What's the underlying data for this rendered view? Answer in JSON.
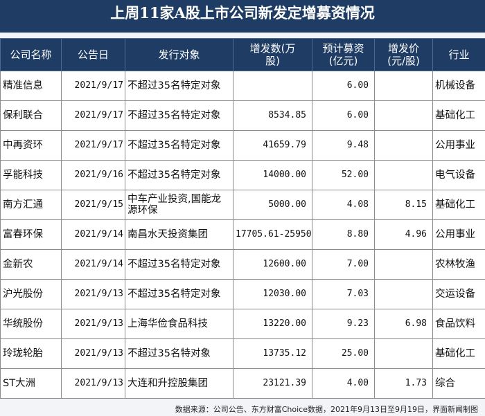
{
  "title": "上周11家A股上市公司新发定增募资情况",
  "headers": [
    "公司名称",
    "公告日",
    "发行对象",
    "增发数(万\n股)",
    "预计募资\n(亿元)",
    "增发价\n(元/股)",
    "行业"
  ],
  "rows": [
    {
      "company": "精准信息",
      "date": "2021/9/17",
      "target": "不超过35名特定对象",
      "shares": "",
      "raise": "6.00",
      "price": "",
      "industry": "机械设备"
    },
    {
      "company": "保利联合",
      "date": "2021/9/17",
      "target": "不超过35名特定对象",
      "shares": "8534.85",
      "raise": "6.00",
      "price": "",
      "industry": "基础化工"
    },
    {
      "company": "中再资环",
      "date": "2021/9/17",
      "target": "不超过35名特定对象",
      "shares": "41659.79",
      "raise": "9.48",
      "price": "",
      "industry": "公用事业"
    },
    {
      "company": "孚能科技",
      "date": "2021/9/16",
      "target": "不超过35名特定对象",
      "shares": "14000.00",
      "raise": "52.00",
      "price": "",
      "industry": "电气设备"
    },
    {
      "company": "南方汇通",
      "date": "2021/9/15",
      "target": "中车产业投资,国能龙源环保",
      "shares": "5000.00",
      "raise": "4.08",
      "price": "8.15",
      "industry": "基础化工"
    },
    {
      "company": "富春环保",
      "date": "2021/9/14",
      "target": "南昌水天投资集团",
      "shares": "17705.61-25950",
      "raise": "8.80",
      "price": "4.96",
      "industry": "公用事业"
    },
    {
      "company": "金新农",
      "date": "2021/9/14",
      "target": "不超过35名特定对象",
      "shares": "12600.00",
      "raise": "7.00",
      "price": "",
      "industry": "农林牧渔"
    },
    {
      "company": "沪光股份",
      "date": "2021/9/13",
      "target": "不超过35名特定对象",
      "shares": "12030.00",
      "raise": "7.03",
      "price": "",
      "industry": "交运设备"
    },
    {
      "company": "华统股份",
      "date": "2021/9/13",
      "target": "上海华俭食品科技",
      "shares": "13220.00",
      "raise": "9.23",
      "price": "6.98",
      "industry": "食品饮料"
    },
    {
      "company": "玲珑轮胎",
      "date": "2021/9/13",
      "target": "不超过35名特对象",
      "shares": "13735.12",
      "raise": "25.00",
      "price": "",
      "industry": "基础化工"
    },
    {
      "company": "ST大洲",
      "date": "2021/9/13",
      "target": "大连和升控股集团",
      "shares": "23121.39",
      "raise": "4.00",
      "price": "1.73",
      "industry": "综合"
    }
  ],
  "footer": "数据来源：公司公告、东方财富Choice数据，2021年9月13日至9月19日，界面新闻制图",
  "colors": {
    "header_bg": "#1f3d64",
    "header_text": "#ffffff",
    "page_bg": "#f2f4f7"
  }
}
